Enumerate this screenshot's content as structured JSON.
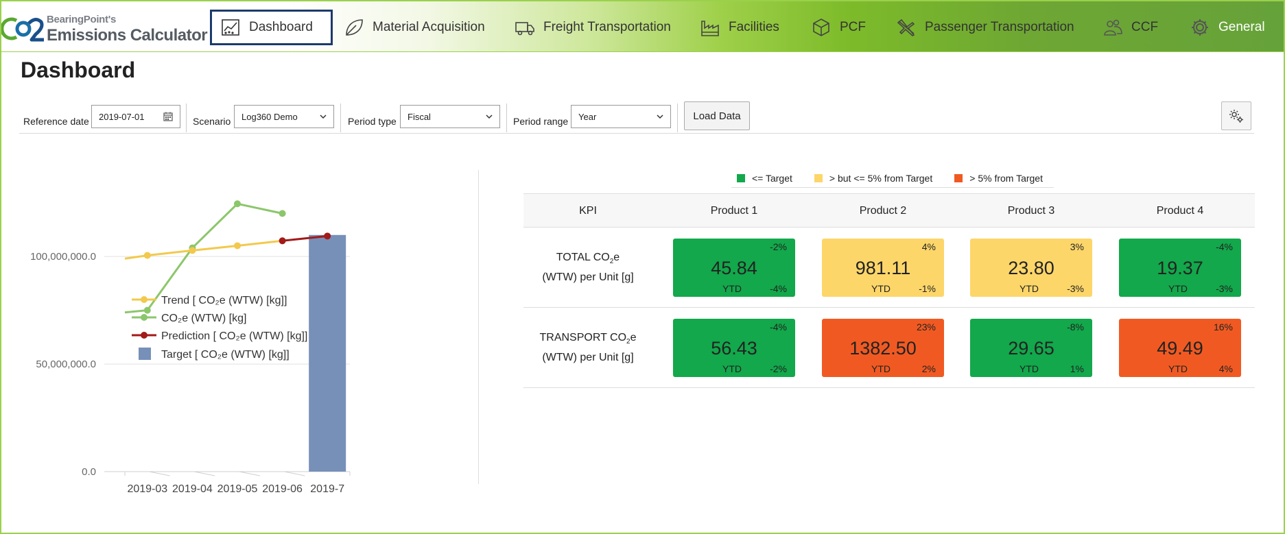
{
  "brand": {
    "line1": "BearingPoint's",
    "line2": "Emissions Calculator"
  },
  "nav": {
    "tabs": [
      {
        "label": "Dashboard",
        "icon": "dashboard-chart-icon",
        "active": true
      },
      {
        "label": "Material Acquisition",
        "icon": "leaf-icon"
      },
      {
        "label": "Freight Transportation",
        "icon": "truck-icon"
      },
      {
        "label": "Facilities",
        "icon": "factory-icon"
      },
      {
        "label": "PCF",
        "icon": "box-icon"
      },
      {
        "label": "Passenger Transportation",
        "icon": "airplane-icon"
      },
      {
        "label": "CCF",
        "icon": "people-icon"
      },
      {
        "label": "General",
        "icon": "gear-cog-icon"
      }
    ]
  },
  "page": {
    "title": "Dashboard"
  },
  "filters": {
    "reference_date_label": "Reference date",
    "reference_date_value": "2019-07-01",
    "scenario_label": "Scenario",
    "scenario_value": "Log360 Demo",
    "period_type_label": "Period type",
    "period_type_value": "Fiscal",
    "period_range_label": "Period range",
    "period_range_value": "Year",
    "load_button": "Load Data"
  },
  "chart_data": {
    "type": "line",
    "categories": [
      "2019-03",
      "2019-04",
      "2019-05",
      "2019-06",
      "2019-7"
    ],
    "yticks": [
      "0.0",
      "50,000,000.0",
      "100,000,000.0"
    ],
    "ylim": [
      0,
      130000000
    ],
    "grid": true,
    "legend_placement": "bottom-left",
    "series": [
      {
        "name": "Trend [ CO₂e (WTW) [kg]]",
        "type": "line",
        "color": "#f2c94c",
        "points": [
          [
            -0.5,
            99000000
          ],
          [
            0,
            100500000
          ],
          [
            1,
            102800000
          ],
          [
            2,
            105000000
          ],
          [
            3,
            107300000
          ]
        ]
      },
      {
        "name": "CO₂e (WTW) [kg]",
        "type": "line",
        "color": "#8cc66b",
        "points": [
          [
            -0.5,
            74000000
          ],
          [
            0,
            75000000
          ],
          [
            1,
            104000000
          ],
          [
            2,
            124500000
          ],
          [
            3,
            120000000
          ]
        ]
      },
      {
        "name": "Prediction [ CO₂e (WTW) [kg]]",
        "type": "line",
        "color": "#a21a1a",
        "points": [
          [
            3,
            107300000
          ],
          [
            4,
            109500000
          ]
        ]
      },
      {
        "name": "Target [ CO₂e (WTW) [kg]]",
        "type": "bar",
        "color": "#7690b8",
        "points": [
          [
            4,
            110000000
          ]
        ]
      }
    ]
  },
  "kpi_legend": [
    {
      "label": "<= Target",
      "color": "#12a84b"
    },
    {
      "label": "> but <= 5% from Target",
      "color": "#fdd66a"
    },
    {
      "label": "> 5% from Target",
      "color": "#f05a22"
    }
  ],
  "kpi_table": {
    "header": [
      "KPI",
      "Product 1",
      "Product 2",
      "Product 3",
      "Product 4"
    ],
    "rows": [
      {
        "label_prefix": "TOTAL CO",
        "label_sub": "2",
        "label_suffix": "e",
        "label_line2": "(WTW) per Unit [g]",
        "cells": [
          {
            "value": "45.84",
            "pct": "-2%",
            "ytd_label": "YTD",
            "ytd": "-4%",
            "status": "green"
          },
          {
            "value": "981.11",
            "pct": "4%",
            "ytd_label": "YTD",
            "ytd": "-1%",
            "status": "yellow"
          },
          {
            "value": "23.80",
            "pct": "3%",
            "ytd_label": "YTD",
            "ytd": "-3%",
            "status": "yellow"
          },
          {
            "value": "19.37",
            "pct": "-4%",
            "ytd_label": "YTD",
            "ytd": "-3%",
            "status": "green"
          }
        ]
      },
      {
        "label_prefix": "TRANSPORT CO",
        "label_sub": "2",
        "label_suffix": "e",
        "label_line2": "(WTW) per Unit [g]",
        "cells": [
          {
            "value": "56.43",
            "pct": "-4%",
            "ytd_label": "YTD",
            "ytd": "-2%",
            "status": "green"
          },
          {
            "value": "1382.50",
            "pct": "23%",
            "ytd_label": "YTD",
            "ytd": "2%",
            "status": "red"
          },
          {
            "value": "29.65",
            "pct": "-8%",
            "ytd_label": "YTD",
            "ytd": "1%",
            "status": "green"
          },
          {
            "value": "49.49",
            "pct": "16%",
            "ytd_label": "YTD",
            "ytd": "4%",
            "status": "red"
          }
        ]
      }
    ]
  }
}
